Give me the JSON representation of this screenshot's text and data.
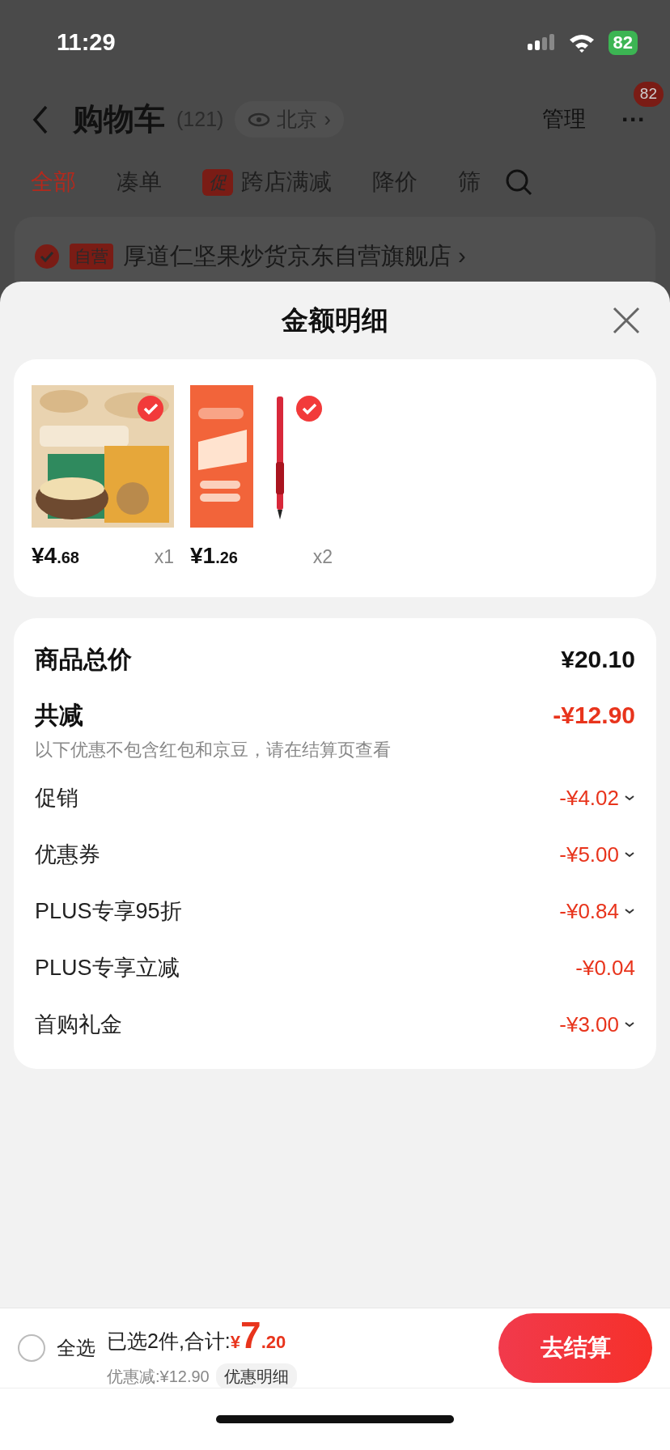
{
  "status_bar": {
    "time": "11:29",
    "battery": "82"
  },
  "header": {
    "title": "购物车",
    "count": "(121)",
    "location": "北京",
    "location_arrow": "›",
    "manage": "管理",
    "more": "···",
    "more_badge": "82"
  },
  "tabs": [
    {
      "label": "全部",
      "selected": true
    },
    {
      "label": "凑单",
      "selected": false
    },
    {
      "label": "跨店满减",
      "selected": false,
      "tag": "促"
    },
    {
      "label": "降价",
      "selected": false
    },
    {
      "label": "筛",
      "selected": false
    }
  ],
  "store": {
    "checked": true,
    "tag": "自营",
    "name": "厚道仁坚果炒货京东自营旗舰店",
    "arrow": "›"
  },
  "sheet": {
    "title": "金额明细",
    "products": [
      {
        "kind": "picture",
        "checked": true,
        "price_main": "¥4",
        "price_cents": ".68",
        "quantity": "x1"
      },
      {
        "kind": "picture",
        "checked": true,
        "price_main": "¥1",
        "price_cents": ".26",
        "quantity": "x2"
      }
    ],
    "total": {
      "label": "商品总价",
      "amount": "¥20.10"
    },
    "discount": {
      "label": "共减",
      "amount": "-¥12.90",
      "note": "以下优惠不包含红包和京豆，请在结算页查看"
    },
    "discount_rows": [
      {
        "label": "促销",
        "amount": "-¥4.02",
        "expandable": true
      },
      {
        "label": "优惠券",
        "amount": "-¥5.00",
        "expandable": true
      },
      {
        "label": "PLUS专享95折",
        "amount": "-¥0.84",
        "expandable": true
      },
      {
        "label": "PLUS专享立减",
        "amount": "-¥0.04",
        "expandable": false
      },
      {
        "label": "首购礼金",
        "amount": "-¥3.00",
        "expandable": true
      }
    ]
  },
  "bottom_bar": {
    "select_all": {
      "label": "全选",
      "checked": false
    },
    "selected_text": "已选2件,合计:",
    "total_currency": "¥",
    "total_main": "7",
    "total_cents": ".20",
    "saved": "优惠减:¥12.90",
    "detail_link": "优惠明细",
    "checkout": "去结算"
  }
}
